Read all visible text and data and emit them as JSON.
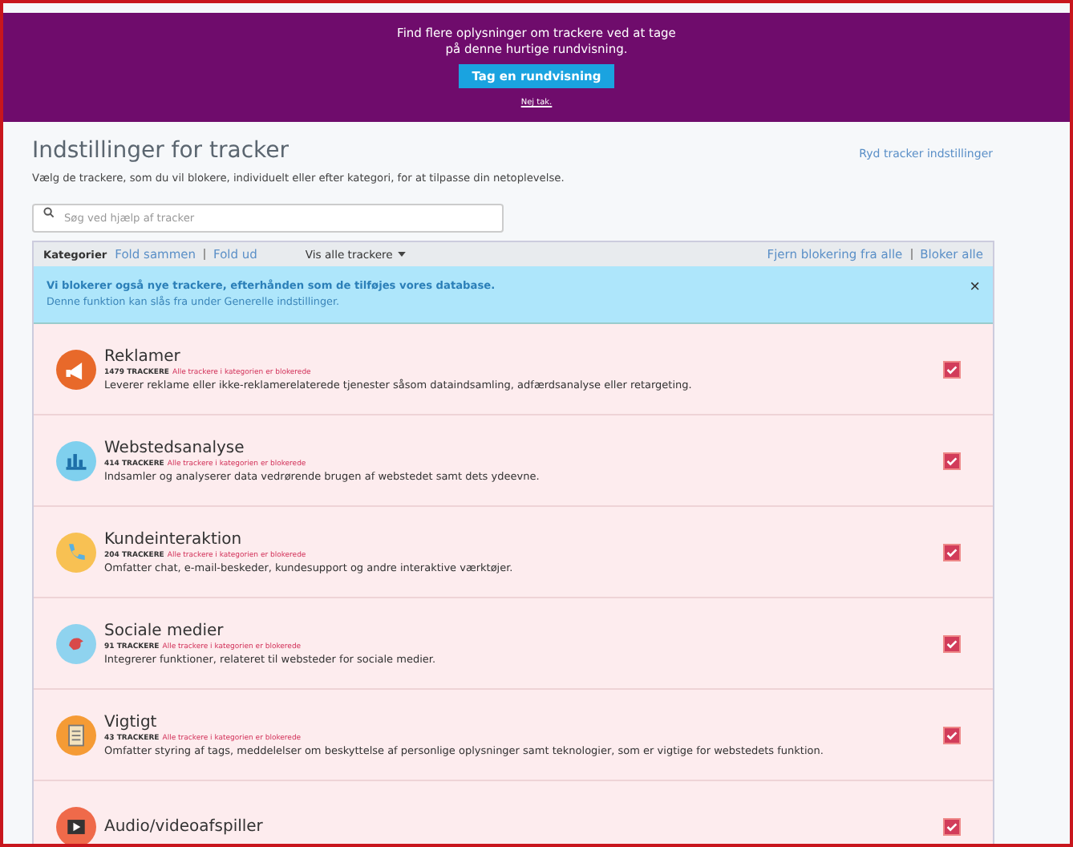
{
  "banner": {
    "message": "Find flere oplysninger om trackere ved at tage på denne hurtige rundvisning.",
    "tour_button": "Tag en rundvisning",
    "dismiss_link": "Nej tak."
  },
  "header": {
    "title": "Indstillinger for tracker",
    "reset_link": "Ryd tracker indstillinger",
    "subtitle": "Vælg de trackere, som du vil blokere, individuelt eller efter kategori, for at tilpasse din netoplevelse."
  },
  "search": {
    "placeholder": "Søg ved hjælp af tracker"
  },
  "toolbar": {
    "label": "Kategorier",
    "collapse": "Fold sammen",
    "expand": "Fold ud",
    "filter": "Vis alle trackere",
    "unblock_all": "Fjern blokering fra alle",
    "block_all": "Bloker alle"
  },
  "notice": {
    "title": "Vi blokerer også nye trackere, efterhånden som de tilføjes vores database.",
    "text": "Denne funktion kan slås fra under Generelle indstillinger.",
    "close": "×"
  },
  "categories": [
    {
      "name": "Reklamer",
      "kind": "megaphone",
      "color": "#e8692a",
      "count": "1479 TRACKERE",
      "status": "Alle trackere i kategorien er blokerede",
      "description": "Leverer reklame eller ikke-reklamerelaterede tjenester såsom dataindsamling, adfærdsanalyse eller retargeting.",
      "checked": true
    },
    {
      "name": "Webstedsanalyse",
      "kind": "chart",
      "color": "#7fd0ee",
      "count": "414 TRACKERE",
      "status": "Alle trackere i kategorien er blokerede",
      "description": "Indsamler og analyserer data vedrørende brugen af webstedet samt dets ydeevne.",
      "checked": true
    },
    {
      "name": "Kundeinteraktion",
      "kind": "phone",
      "color": "#f8c153",
      "count": "204 TRACKERE",
      "status": "Alle trackere i kategorien er blokerede",
      "description": "Omfatter chat, e-mail-beskeder, kundesupport og andre interaktive værktøjer.",
      "checked": true
    },
    {
      "name": "Sociale medier",
      "kind": "bird",
      "color": "#8fd3ef",
      "count": "91 TRACKERE",
      "status": "Alle trackere i kategorien er blokerede",
      "description": "Integrerer funktioner, relateret til websteder for sociale medier.",
      "checked": true
    },
    {
      "name": "Vigtigt",
      "kind": "clipboard",
      "color": "#f59b35",
      "count": "43 TRACKERE",
      "status": "Alle trackere i kategorien er blokerede",
      "description": "Omfatter styring af tags, meddelelser om beskyttelse af personlige oplysninger samt teknologier, som er vigtige for webstedets funktion.",
      "checked": true
    },
    {
      "name": "Audio/videoafspiller",
      "kind": "play",
      "color": "#ef6a4a",
      "checked": true
    }
  ]
}
